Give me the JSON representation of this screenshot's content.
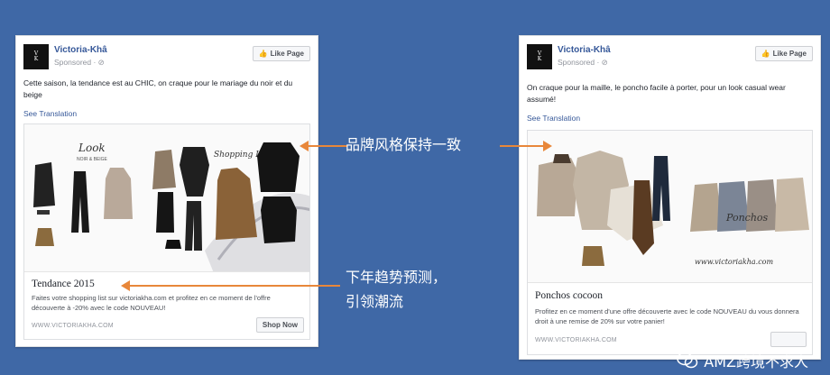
{
  "ads": [
    {
      "page_name": "Victoria-Khâ",
      "sponsored": "Sponsored · ⊘",
      "like_button": "Like Page",
      "post_text": "Cette saison, la tendance est au CHIC, on craque pour le mariage du noir et du beige",
      "see_translation": "See Translation",
      "image_labels": {
        "look": "Look",
        "look_sub": "NOIR & BEIGE",
        "shopping": "Shopping List"
      },
      "title": "Tendance 2015",
      "description": "Faites votre shopping list sur victoriakha.com et profitez en ce moment de l'offre découverte à -20% avec le code NOUVEAU!",
      "domain": "WWW.VICTORIAKHA.COM",
      "cta": "Shop Now"
    },
    {
      "page_name": "Victoria-Khâ",
      "sponsored": "Sponsored · ⊘",
      "like_button": "Like Page",
      "post_text": "On craque pour la maille, le poncho facile à porter, pour un look casual wear assumé!",
      "see_translation": "See Translation",
      "image_labels": {
        "ponchos": "Ponchos",
        "site": "www.victoriakha.com"
      },
      "title": "Ponchos cocoon",
      "description": "Profitez en ce moment d'une offre découverte avec le code NOUVEAU du vous donnera droit à une remise de 20% sur votre panier!",
      "domain": "WWW.VICTORIAKHA.COM",
      "cta": ""
    }
  ],
  "annotations": {
    "brand_style": "品牌风格保持一致",
    "trend_line1": "下年趋势预测，",
    "trend_line2": "引领潮流"
  },
  "watermark": "AMZ跨境不求人",
  "colors": {
    "background": "#3f68a6",
    "arrow": "#e8873a",
    "link": "#365899"
  }
}
